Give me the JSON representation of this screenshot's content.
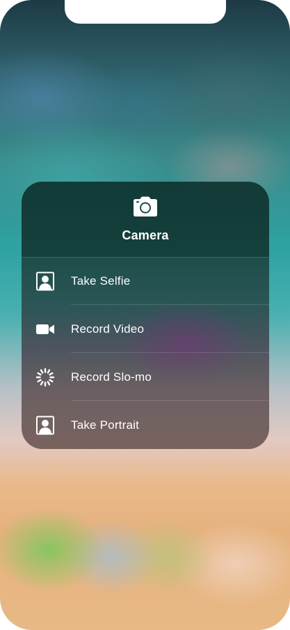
{
  "screen": {
    "background": "blurred-home-screen-wallpaper"
  },
  "quick_actions_menu": {
    "app_icon": "camera-icon",
    "app_name": "Camera",
    "items": [
      {
        "label": "Take Selfie",
        "icon": "selfie-portrait-icon"
      },
      {
        "label": "Record Video",
        "icon": "video-camera-icon"
      },
      {
        "label": "Record Slo-mo",
        "icon": "slo-mo-dial-icon"
      },
      {
        "label": "Take Portrait",
        "icon": "portrait-icon"
      }
    ]
  },
  "colors": {
    "menu_text": "#ffffff",
    "menu_tint": "#1f4a45"
  }
}
